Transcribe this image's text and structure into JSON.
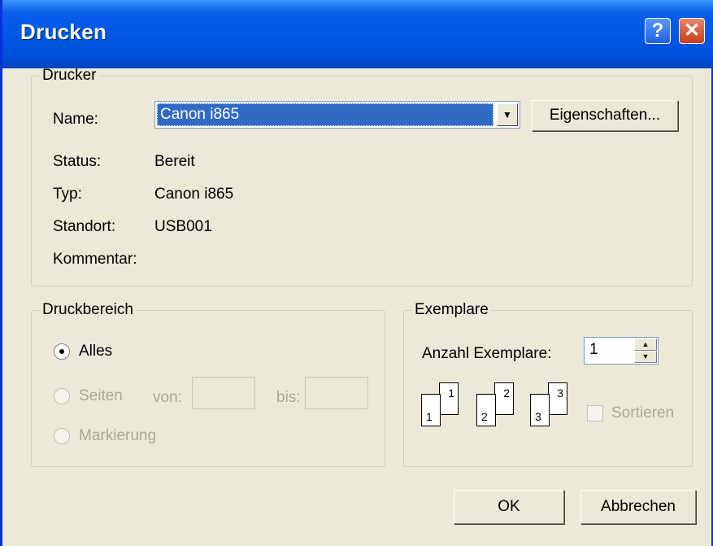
{
  "window": {
    "title": "Drucken"
  },
  "titlebar": {
    "help_glyph": "?",
    "close_glyph": "✕"
  },
  "printer": {
    "group_label": "Drucker",
    "name_label": "Name:",
    "name_value": "Canon i865",
    "properties_button": "Eigenschaften...",
    "status_label": "Status:",
    "status_value": "Bereit",
    "type_label": "Typ:",
    "type_value": "Canon i865",
    "location_label": "Standort:",
    "location_value": "USB001",
    "comment_label": "Kommentar:",
    "comment_value": ""
  },
  "range": {
    "group_label": "Druckbereich",
    "all_label": "Alles",
    "all_selected": true,
    "pages_label": "Seiten",
    "from_label": "von:",
    "from_value": "",
    "to_label": "bis:",
    "to_value": "",
    "selection_label": "Markierung"
  },
  "copies": {
    "group_label": "Exemplare",
    "count_label": "Anzahl Exemplare:",
    "count_value": "1",
    "collate_label": "Sortieren",
    "collate_checked": false,
    "collate_icon_numbers": [
      "1",
      "1",
      "2",
      "2",
      "3",
      "3"
    ]
  },
  "buttons": {
    "ok": "OK",
    "cancel": "Abbrechen"
  },
  "colors": {
    "titlebar": "#0058E6",
    "dialog_bg": "#ECE9D8",
    "selection": "#316AC5",
    "disabled_text": "#ACA899"
  }
}
